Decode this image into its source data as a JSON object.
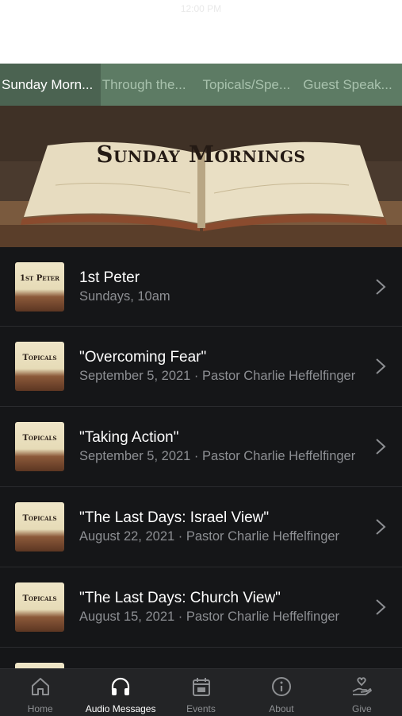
{
  "status": {
    "time": "12:00 PM"
  },
  "tabs": [
    {
      "label": "Sunday Morn...",
      "active": true
    },
    {
      "label": "Through the...",
      "active": false
    },
    {
      "label": "Topicals/Spe...",
      "active": false
    },
    {
      "label": "Guest Speak...",
      "active": false
    }
  ],
  "hero": {
    "title": "Sunday Mornings"
  },
  "items": [
    {
      "thumb": "1st Peter",
      "title": "1st Peter",
      "subtitle": "Sundays, 10am"
    },
    {
      "thumb": "Topicals",
      "title": "\"Overcoming Fear\"",
      "subtitle": "September 5, 2021 · Pastor Charlie Heffelfinger"
    },
    {
      "thumb": "Topicals",
      "title": "\"Taking Action\"",
      "subtitle": "September 5, 2021 · Pastor Charlie Heffelfinger"
    },
    {
      "thumb": "Topicals",
      "title": "\"The Last Days: Israel View\"",
      "subtitle": "August 22, 2021 · Pastor Charlie Heffelfinger"
    },
    {
      "thumb": "Topicals",
      "title": "\"The Last Days: Church View\"",
      "subtitle": "August 15, 2021 · Pastor Charlie Heffelfinger"
    }
  ],
  "tabbar": [
    {
      "label": "Home",
      "icon": "home-icon",
      "active": false
    },
    {
      "label": "Audio Messages",
      "icon": "headphones-icon",
      "active": true
    },
    {
      "label": "Events",
      "icon": "calendar-icon",
      "active": false
    },
    {
      "label": "About",
      "icon": "info-icon",
      "active": false
    },
    {
      "label": "Give",
      "icon": "give-icon",
      "active": false
    }
  ],
  "colors": {
    "accent": "#5d7b64",
    "accent_active": "#4b6351",
    "list_bg": "#151618",
    "tabbar_bg": "#232426"
  }
}
